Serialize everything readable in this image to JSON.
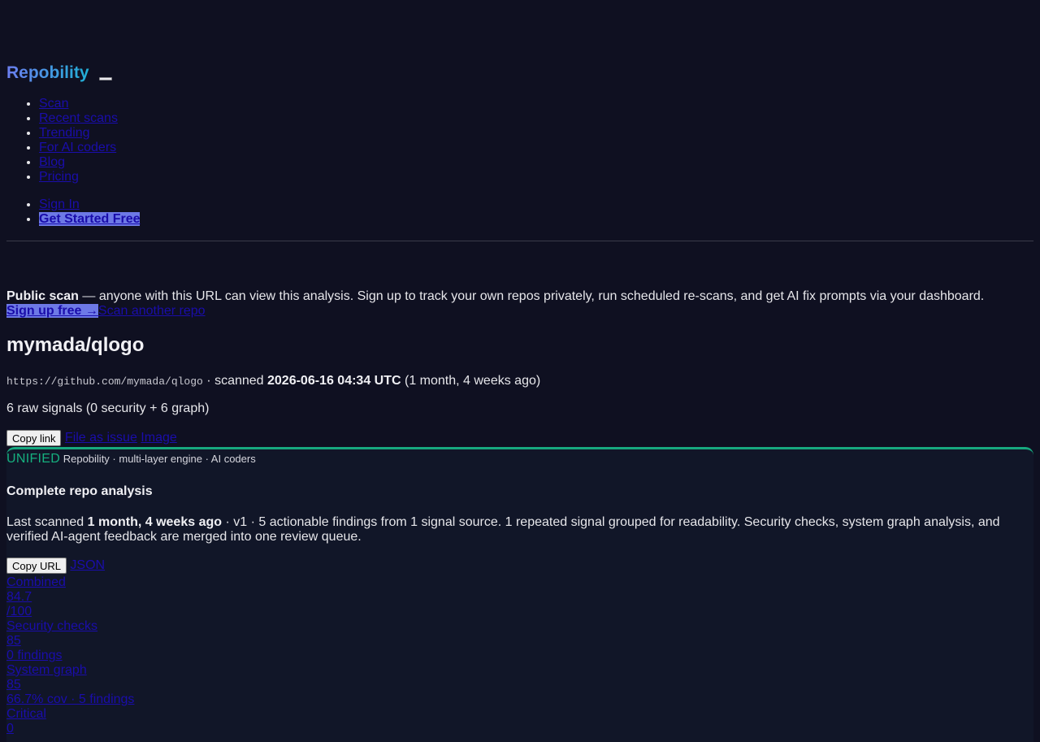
{
  "header": {
    "brand": "Repobility",
    "nav": [
      "Scan",
      "Recent scans",
      "Trending",
      "For AI coders",
      "Blog",
      "Pricing"
    ],
    "sign_in": "Sign In",
    "get_started": "Get Started Free"
  },
  "notice": {
    "bold": "Public scan",
    "text": " — anyone with this URL can view this analysis. Sign up to track your own repos privately, run scheduled re-scans, and get AI fix prompts via your dashboard.",
    "signup": "Sign up free →",
    "scan_another": "Scan another repo"
  },
  "repo": {
    "title": "mymada/qlogo",
    "url": "https://github.com/mymada/qlogo",
    "scanned_prefix": " · scanned ",
    "scanned_at": "2026-06-16 04:34 UTC",
    "scanned_ago": " (1 month, 4 weeks ago)",
    "signals": "6 raw signals (0 security + 6 graph)"
  },
  "actions": {
    "copy_link": "Copy link",
    "file_issue": "File as issue",
    "image": "Image"
  },
  "panel": {
    "badge": "UNIFIED",
    "engine": " Repobility · multi-layer engine · AI coders",
    "heading": "Complete repo analysis",
    "summary_prefix": "Last scanned ",
    "summary_bold": "1 month, 4 weeks ago",
    "summary_rest": " · v1 · 5 actionable findings from 1 signal source. 1 repeated signal grouped for readability. Security checks, system graph analysis, and verified AI-agent feedback are merged into one review queue.",
    "copy_url": "Copy URL",
    "json": "JSON"
  },
  "stats": [
    {
      "label": "Combined",
      "value": "84.7",
      "sub": "/100"
    },
    {
      "label": "Security checks",
      "value": "85",
      "sub": "0 findings"
    },
    {
      "label": "System graph",
      "value": "85",
      "sub": "66.7% cov · 5 findings"
    },
    {
      "label": "Critical",
      "value": "0"
    }
  ]
}
